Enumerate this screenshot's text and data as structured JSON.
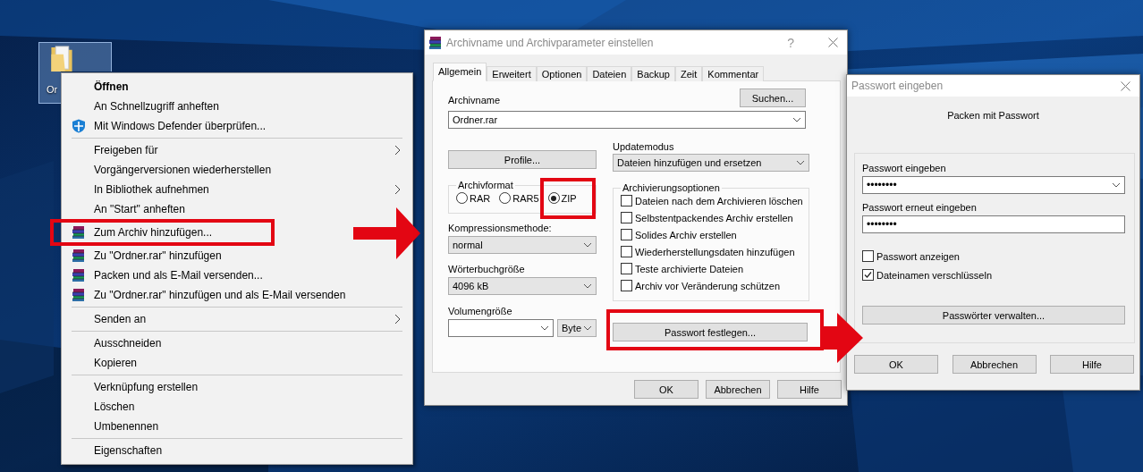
{
  "desktop_icon": {
    "label": "Or",
    "selected": true
  },
  "context_menu": {
    "items": [
      {
        "kind": "plain",
        "label": "Öffnen",
        "default": true,
        "submenu": false
      },
      {
        "kind": "plain",
        "label": "An Schnellzugriff anheften",
        "default": false,
        "submenu": false
      },
      {
        "kind": "shield",
        "label": "Mit Windows Defender überprüfen...",
        "default": false,
        "submenu": false
      },
      {
        "kind": "separator"
      },
      {
        "kind": "plain",
        "label": "Freigeben für",
        "default": false,
        "submenu": true
      },
      {
        "kind": "plain",
        "label": "Vorgängerversionen wiederherstellen",
        "default": false,
        "submenu": false
      },
      {
        "kind": "plain",
        "label": "In Bibliothek aufnehmen",
        "default": false,
        "submenu": true
      },
      {
        "kind": "plain",
        "label": "An \"Start\" anheften",
        "default": false,
        "submenu": false
      },
      {
        "kind": "archive",
        "label": "Zum Archiv hinzufügen...",
        "default": false,
        "submenu": false,
        "annotated": true
      },
      {
        "kind": "archive",
        "label": "Zu \"Ordner.rar\" hinzufügen",
        "default": false,
        "submenu": false
      },
      {
        "kind": "archive",
        "label": "Packen und als E-Mail versenden...",
        "default": false,
        "submenu": false
      },
      {
        "kind": "archive",
        "label": "Zu \"Ordner.rar\" hinzufügen und als E-Mail versenden",
        "default": false,
        "submenu": false
      },
      {
        "kind": "separator"
      },
      {
        "kind": "plain",
        "label": "Senden an",
        "default": false,
        "submenu": true
      },
      {
        "kind": "separator"
      },
      {
        "kind": "plain",
        "label": "Ausschneiden",
        "default": false,
        "submenu": false
      },
      {
        "kind": "plain",
        "label": "Kopieren",
        "default": false,
        "submenu": false
      },
      {
        "kind": "separator"
      },
      {
        "kind": "plain",
        "label": "Verknüpfung erstellen",
        "default": false,
        "submenu": false
      },
      {
        "kind": "plain",
        "label": "Löschen",
        "default": false,
        "submenu": false
      },
      {
        "kind": "plain",
        "label": "Umbenennen",
        "default": false,
        "submenu": false
      },
      {
        "kind": "separator"
      },
      {
        "kind": "plain",
        "label": "Eigenschaften",
        "default": false,
        "submenu": false
      }
    ]
  },
  "archive_dialog": {
    "title": "Archivname und Archivparameter einstellen",
    "help_button": "?",
    "tabs": [
      {
        "label": "Allgemein",
        "selected": true
      },
      {
        "label": "Erweitert",
        "selected": false
      },
      {
        "label": "Optionen",
        "selected": false
      },
      {
        "label": "Dateien",
        "selected": false
      },
      {
        "label": "Backup",
        "selected": false
      },
      {
        "label": "Zeit",
        "selected": false
      },
      {
        "label": "Kommentar",
        "selected": false
      }
    ],
    "archive_name": {
      "label": "Archivname",
      "value": "Ordner.rar"
    },
    "browse_button": "Suchen...",
    "profiles_button": "Profile...",
    "update_mode": {
      "label": "Updatemodus",
      "value": "Dateien hinzufügen und ersetzen"
    },
    "archive_format": {
      "label": "Archivformat",
      "options": [
        {
          "label": "RAR",
          "selected": false
        },
        {
          "label": "RAR5",
          "selected": false
        },
        {
          "label": "ZIP",
          "selected": true,
          "annotated": true
        }
      ]
    },
    "archive_options": {
      "label": "Archivierungsoptionen",
      "options": [
        {
          "label": "Dateien nach dem Archivieren löschen",
          "checked": false
        },
        {
          "label": "Selbstentpackendes Archiv erstellen",
          "checked": false
        },
        {
          "label": "Solides Archiv erstellen",
          "checked": false
        },
        {
          "label": "Wiederherstellungsdaten hinzufügen",
          "checked": false
        },
        {
          "label": "Teste archivierte Dateien",
          "checked": false
        },
        {
          "label": "Archiv vor Veränderung schützen",
          "checked": false
        }
      ]
    },
    "compression_method": {
      "label": "Kompressionsmethode:",
      "value": "normal"
    },
    "dictionary_size": {
      "label": "Wörterbuchgröße",
      "value": "4096 kB"
    },
    "volume_size": {
      "label": "Volumengröße",
      "unit": "Byte"
    },
    "password_button": {
      "label": "Passwort festlegen...",
      "annotated": true
    },
    "buttons": [
      "OK",
      "Abbrechen",
      "Hilfe"
    ]
  },
  "password_dialog": {
    "title": "Passwort eingeben",
    "heading": "Packen mit Passwort",
    "password": {
      "label": "Passwort eingeben",
      "value": "••••••••"
    },
    "confirm": {
      "label": "Passwort erneut eingeben",
      "value": "••••••••"
    },
    "options": [
      {
        "label": "Passwort anzeigen",
        "checked": false
      },
      {
        "label": "Dateinamen verschlüsseln",
        "checked": true
      }
    ],
    "manage_button": "Passwörter verwalten...",
    "buttons": [
      "OK",
      "Abbrechen",
      "Hilfe"
    ]
  }
}
